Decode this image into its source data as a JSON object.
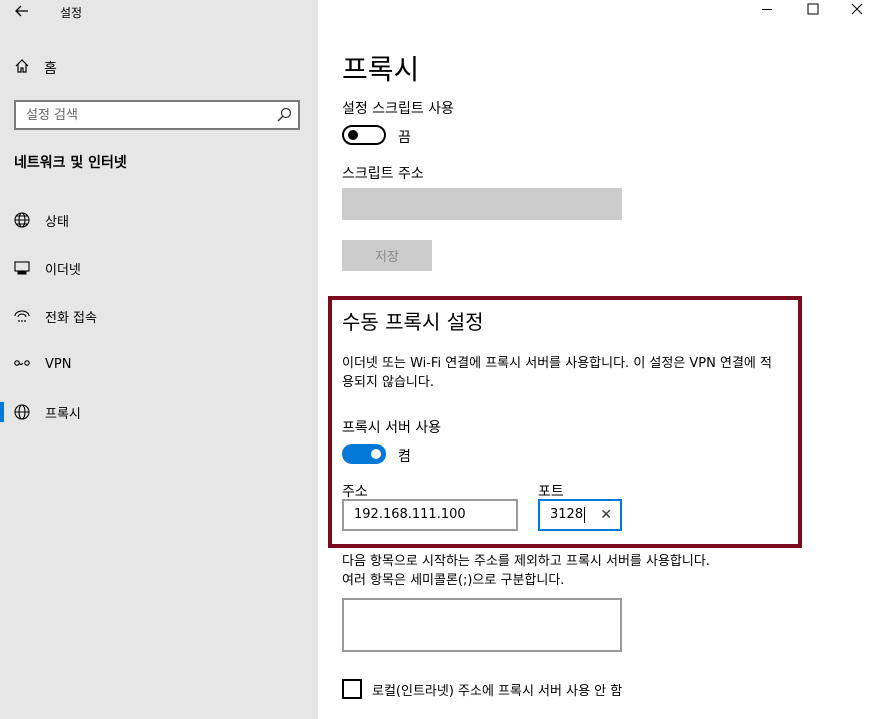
{
  "window": {
    "title": "설정",
    "back_icon": "back-arrow-icon",
    "minimize": "—",
    "maximize": "☐",
    "close": "✕"
  },
  "sidebar": {
    "home_label": "홈",
    "search_placeholder": "설정 검색",
    "section_title": "네트워크 및 인터넷",
    "items": [
      {
        "label": "상태",
        "icon": "globe-status-icon"
      },
      {
        "label": "이더넷",
        "icon": "ethernet-icon"
      },
      {
        "label": "전화 접속",
        "icon": "dialup-icon"
      },
      {
        "label": "VPN",
        "icon": "vpn-icon"
      },
      {
        "label": "프록시",
        "icon": "globe-icon",
        "active": true
      }
    ]
  },
  "main": {
    "page_title": "프록시",
    "script_setting_label": "설정 스크립트 사용",
    "script_toggle_state": "끔",
    "script_address_label": "스크립트 주소",
    "script_address_value": "",
    "save_label": "저장",
    "manual_title": "수동 프록시 설정",
    "manual_desc": "이더넷 또는 Wi-Fi 연결에 프록시 서버를 사용합니다. 이 설정은 VPN 연결에 적용되지 않습니다.",
    "use_proxy_label": "프록시 서버 사용",
    "proxy_toggle_state": "켬",
    "address_label": "주소",
    "address_value": "192.168.111.100",
    "port_label": "포트",
    "port_value": "3128",
    "clear_glyph": "✕",
    "exceptions_desc_line1": "다음 항목으로 시작하는 주소를 제외하고 프록시 서버를 사용합니다.",
    "exceptions_desc_line2": "여러 항목은 세미콜론(;)으로 구분합니다.",
    "exceptions_value": "",
    "local_bypass_label": "로컬(인트라넷) 주소에 프록시 서버 사용 안 함"
  },
  "colors": {
    "accent": "#0078d7",
    "highlight_border": "#7b0c1e",
    "sidebar_bg": "#e6e6e6",
    "disabled_bg": "#cccccc"
  }
}
